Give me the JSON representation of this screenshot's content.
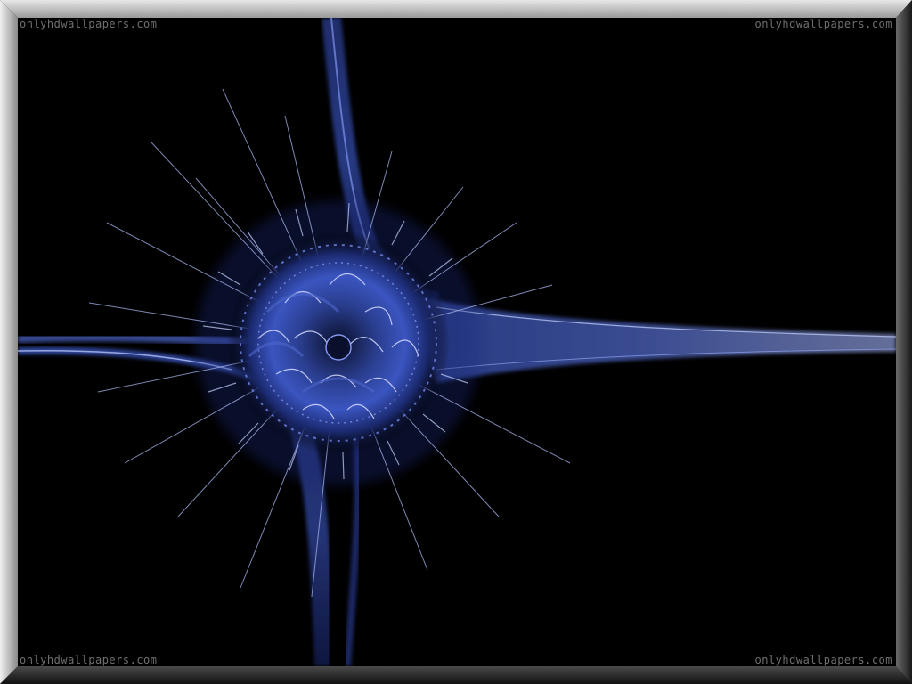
{
  "watermarks": {
    "top_left": "onlyhdwallpapers.com",
    "top_right": "onlyhdwallpapers.com",
    "bottom_left": "onlyhdwallpapers.com",
    "bottom_right": "onlyhdwallpapers.com"
  },
  "colors": {
    "background": "#000000",
    "fractal_primary": "#3c5ac8",
    "fractal_highlight": "#c8d4ff",
    "frame_light": "#d9d9d9",
    "frame_dark": "#262626"
  },
  "image": {
    "subject": "fractal-spore-icon"
  }
}
